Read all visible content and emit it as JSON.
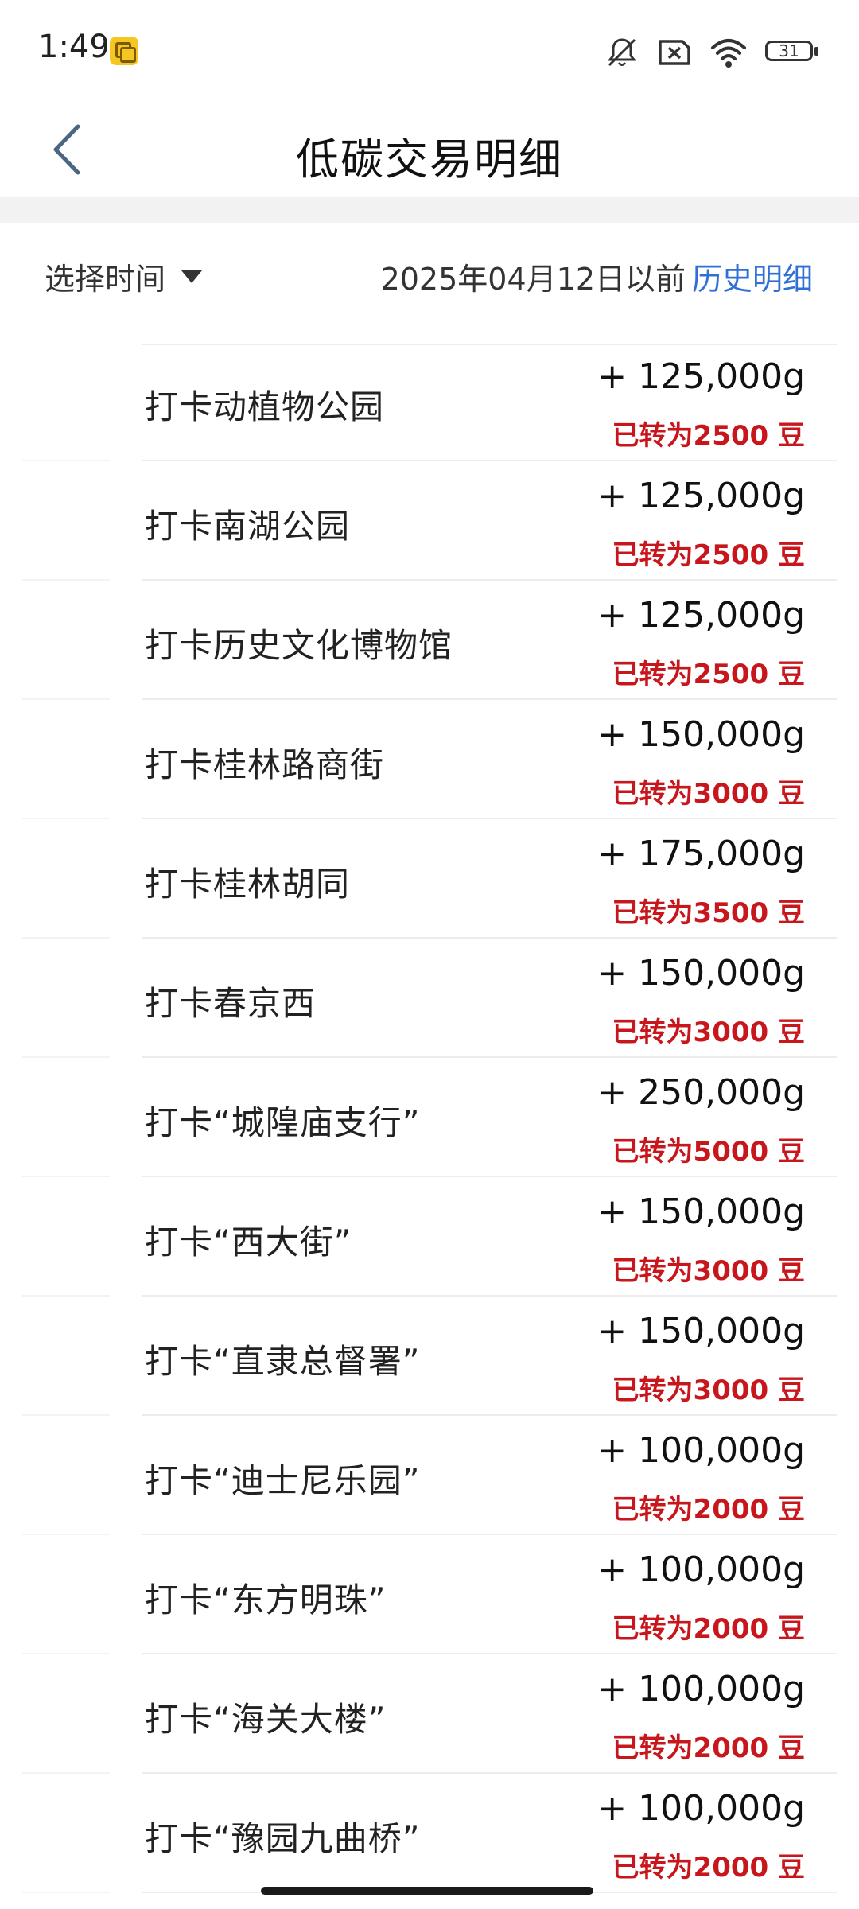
{
  "status_bar": {
    "time": "1:49",
    "battery": "31",
    "icons": [
      "app-notification-icon",
      "mute-icon",
      "sim-off-icon",
      "wifi-icon",
      "battery-icon"
    ]
  },
  "header": {
    "title": "低碳交易明细"
  },
  "filter": {
    "select_label": "选择时间",
    "before_date": "2025年04月12日以前",
    "history_link": "历史明细"
  },
  "colors": {
    "accent_link": "#2f6fd6",
    "converted_red": "#c8171c"
  },
  "items": [
    {
      "title": "打卡动植物公园",
      "amount": "+ 125,000g",
      "converted": "已转为2500 豆"
    },
    {
      "title": "打卡南湖公园",
      "amount": "+ 125,000g",
      "converted": "已转为2500 豆"
    },
    {
      "title": "打卡历史文化博物馆",
      "amount": "+ 125,000g",
      "converted": "已转为2500 豆"
    },
    {
      "title": "打卡桂林路商街",
      "amount": "+ 150,000g",
      "converted": "已转为3000 豆"
    },
    {
      "title": "打卡桂林胡同",
      "amount": "+ 175,000g",
      "converted": "已转为3500 豆"
    },
    {
      "title": "打卡春京西",
      "amount": "+ 150,000g",
      "converted": "已转为3000 豆"
    },
    {
      "title": "打卡“城隍庙支行”",
      "amount": "+ 250,000g",
      "converted": "已转为5000 豆"
    },
    {
      "title": "打卡“西大街”",
      "amount": "+ 150,000g",
      "converted": "已转为3000 豆"
    },
    {
      "title": "打卡“直隶总督署”",
      "amount": "+ 150,000g",
      "converted": "已转为3000 豆"
    },
    {
      "title": "打卡“迪士尼乐园”",
      "amount": "+ 100,000g",
      "converted": "已转为2000 豆"
    },
    {
      "title": "打卡“东方明珠”",
      "amount": "+ 100,000g",
      "converted": "已转为2000 豆"
    },
    {
      "title": "打卡“海关大楼”",
      "amount": "+ 100,000g",
      "converted": "已转为2000 豆"
    },
    {
      "title": "打卡“豫园九曲桥”",
      "amount": "+ 100,000g",
      "converted": "已转为2000 豆"
    }
  ]
}
